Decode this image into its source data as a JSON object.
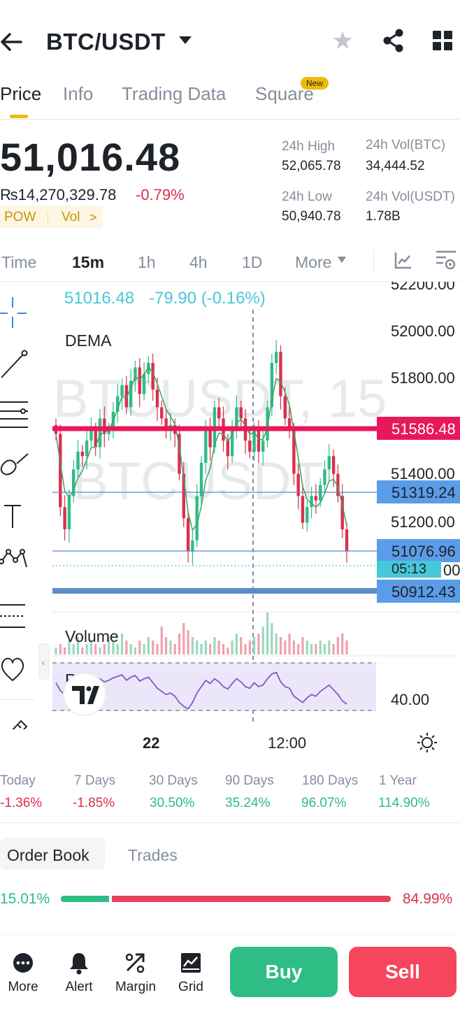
{
  "header": {
    "back_icon": "arrow-left-icon",
    "pair": "BTC/USDT",
    "icons": [
      "chevron-down-icon",
      "star-icon",
      "share-icon",
      "grid-icon"
    ]
  },
  "tabs": [
    {
      "label": "Price",
      "active": true
    },
    {
      "label": "Info"
    },
    {
      "label": "Trading Data"
    },
    {
      "label": "Square",
      "badge": "New"
    }
  ],
  "price": {
    "last": "51,016.48",
    "fiat": "₨14,270,329.78",
    "change_pct": "-0.79%",
    "tag_pow": "POW",
    "tag_vol": "Vol",
    "tag_caret": ">"
  },
  "stats": {
    "high_label": "24h High",
    "high": "52,065.78",
    "vol_btc_label": "24h Vol(BTC)",
    "vol_btc": "34,444.52",
    "low_label": "24h Low",
    "low": "50,940.78",
    "vol_usdt_label": "24h Vol(USDT)",
    "vol_usdt": "1.78B"
  },
  "intervals": {
    "time": "Time",
    "m15": "15m",
    "h1": "1h",
    "h4": "4h",
    "d1": "1D",
    "more": "More",
    "icons": [
      "chart-type-icon",
      "chart-settings-icon"
    ]
  },
  "chart": {
    "header_price": "51016.48",
    "header_change": "-79.90 (-0.16%)",
    "indicator_main": "DEMA",
    "indicator_volume": "Volume",
    "indicator_rsi": "RSI",
    "watermark1": "BTCUSDT, 15",
    "watermark2": "BTCUSDT",
    "y_ticks": [
      "52200.00",
      "52000.00",
      "51800.00",
      "51400.00",
      "51200.00"
    ],
    "rsi_tick": "40.00",
    "price_labels": {
      "red_line": "51586.48",
      "blue_1": "51319.24",
      "blue_2": "51076.96",
      "countdown": "05:13",
      "countdown_tail": "00",
      "blue_3": "50912.43"
    },
    "x_labels": [
      "22",
      "12:00"
    ],
    "colors": {
      "up": "#2ebd85",
      "down": "#d9304e",
      "red_line": "#e8185a",
      "blue_label": "#5b9ce8",
      "cyan": "#45c8d8",
      "rsi_band": "#ece6fa",
      "rsi_line": "#7c5cbf"
    },
    "toolbar_icons": [
      "crosshair-icon",
      "trend-line-icon",
      "fib-lines-icon",
      "brush-icon",
      "text-icon",
      "pattern-icon",
      "projection-icon",
      "favorites-icon",
      "ruler-icon"
    ]
  },
  "chart_data": {
    "type": "candlestick",
    "interval": "15m",
    "y_range": [
      50800,
      52250
    ],
    "y_ticks": [
      52200,
      52000,
      51800,
      51400,
      51200
    ],
    "horizontal_levels": [
      51586.48,
      51319.24,
      51076.96,
      50912.43
    ],
    "last_price": 51016.48,
    "x_labels": [
      "22",
      "12:00"
    ],
    "closes": [
      51580,
      51250,
      51150,
      51300,
      51420,
      51500,
      51480,
      51550,
      51600,
      51520,
      51650,
      51580,
      51600,
      51680,
      51750,
      51800,
      51700,
      51820,
      51880,
      51760,
      51850,
      51900,
      51780,
      51700,
      51650,
      51600,
      51620,
      51580,
      51400,
      51200,
      51050,
      51100,
      51300,
      51450,
      51600,
      51520,
      51700,
      51650,
      51550,
      51480,
      51600,
      51700,
      51650,
      51550,
      51500,
      51600,
      51500,
      51550,
      51700,
      51900,
      51950,
      51750,
      51650,
      51600,
      51400,
      51300,
      51180,
      51250,
      51300,
      51280,
      51350,
      51420,
      51480,
      51400,
      51300,
      51150,
      51050
    ],
    "volumes": [
      2,
      3,
      2,
      4,
      3,
      5,
      2,
      3,
      4,
      3,
      2,
      3,
      5,
      4,
      3,
      6,
      4,
      3,
      2,
      4,
      3,
      5,
      4,
      3,
      8,
      5,
      4,
      3,
      6,
      9,
      7,
      5,
      4,
      3,
      4,
      3,
      5,
      4,
      3,
      2,
      4,
      6,
      5,
      3,
      4,
      5,
      6,
      8,
      12,
      9,
      6,
      5,
      4,
      6,
      4,
      3,
      5,
      4,
      3,
      3,
      4,
      3,
      4,
      3,
      5,
      6,
      4
    ],
    "rsi": [
      55,
      45,
      40,
      48,
      52,
      56,
      53,
      58,
      62,
      57,
      60,
      56,
      58,
      61,
      63,
      65,
      58,
      62,
      64,
      57,
      60,
      62,
      55,
      48,
      44,
      40,
      42,
      38,
      30,
      25,
      22,
      30,
      42,
      50,
      58,
      54,
      60,
      56,
      50,
      47,
      54,
      60,
      56,
      50,
      48,
      55,
      50,
      52,
      60,
      66,
      68,
      56,
      50,
      48,
      38,
      34,
      30,
      36,
      40,
      38,
      44,
      48,
      52,
      46,
      40,
      32,
      28
    ],
    "rsi_tick": 40
  },
  "performance": [
    {
      "label": "Today",
      "value": "-1.36%",
      "dir": "down"
    },
    {
      "label": "7 Days",
      "value": "-1.85%",
      "dir": "down"
    },
    {
      "label": "30 Days",
      "value": "30.50%",
      "dir": "up"
    },
    {
      "label": "90 Days",
      "value": "35.24%",
      "dir": "up"
    },
    {
      "label": "180 Days",
      "value": "96.07%",
      "dir": "up"
    },
    {
      "label": "1 Year",
      "value": "114.90%",
      "dir": "up"
    }
  ],
  "order_book": {
    "tab_order_book": "Order Book",
    "tab_trades": "Trades",
    "bid_pct": "15.01%",
    "ask_pct": "84.99%",
    "bid_ratio": 0.1501
  },
  "bottom_bar": {
    "more": "More",
    "alert": "Alert",
    "margin": "Margin",
    "grid": "Grid",
    "buy": "Buy",
    "sell": "Sell"
  }
}
